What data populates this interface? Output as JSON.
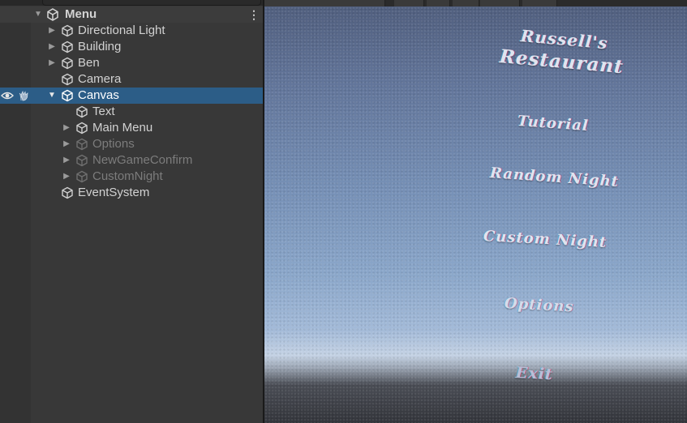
{
  "hierarchy": {
    "scene_name": "Menu",
    "items": [
      {
        "label": "Directional Light",
        "expandable": true,
        "expanded": false,
        "depth": 1,
        "state": "normal"
      },
      {
        "label": "Building",
        "expandable": true,
        "expanded": false,
        "depth": 1,
        "state": "normal"
      },
      {
        "label": "Ben",
        "expandable": true,
        "expanded": false,
        "depth": 1,
        "state": "normal"
      },
      {
        "label": "Camera",
        "expandable": false,
        "expanded": false,
        "depth": 1,
        "state": "normal"
      },
      {
        "label": "Canvas",
        "expandable": true,
        "expanded": true,
        "depth": 1,
        "state": "selected"
      },
      {
        "label": "Text",
        "expandable": false,
        "expanded": false,
        "depth": 2,
        "state": "normal"
      },
      {
        "label": "Main Menu",
        "expandable": true,
        "expanded": false,
        "depth": 2,
        "state": "normal"
      },
      {
        "label": "Options",
        "expandable": true,
        "expanded": false,
        "depth": 2,
        "state": "disabled"
      },
      {
        "label": "NewGameConfirm",
        "expandable": true,
        "expanded": false,
        "depth": 2,
        "state": "disabled"
      },
      {
        "label": "CustomNight",
        "expandable": true,
        "expanded": false,
        "depth": 2,
        "state": "disabled"
      },
      {
        "label": "EventSystem",
        "expandable": false,
        "expanded": false,
        "depth": 1,
        "state": "normal"
      }
    ]
  },
  "game_view": {
    "title_line1": "Russell's",
    "title_line2": "Restaurant",
    "buttons": {
      "tutorial": "Tutorial",
      "random_night": "Random Night",
      "custom_night": "Custom Night",
      "options": "Options",
      "exit": "Exit"
    }
  },
  "colors": {
    "selection": "#2c5d87",
    "panel": "#383838",
    "text": "#d2d2d2",
    "disabled_text": "#7c7c7c"
  }
}
